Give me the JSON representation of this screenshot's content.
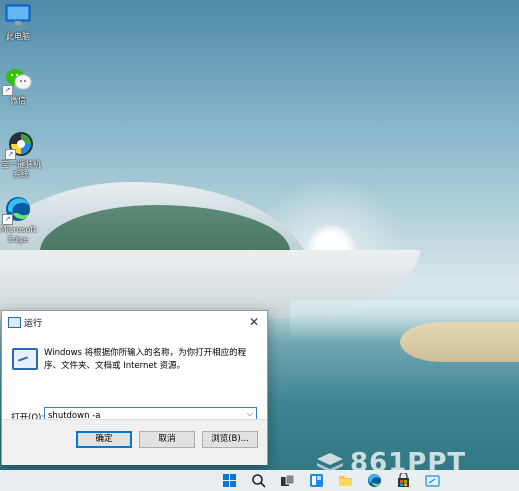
{
  "desktop": {
    "icons": [
      {
        "label": "此电脑",
        "icon": "monitor-icon"
      },
      {
        "label": "微信",
        "icon": "wechat-icon"
      },
      {
        "label": "宝一键装机系统",
        "icon": "installer-icon"
      },
      {
        "label": "Microsoft Edge",
        "icon": "edge-icon"
      }
    ]
  },
  "run_dialog": {
    "title": "运行",
    "close_glyph": "✕",
    "description": "Windows 将根据你所输入的名称，为你打开相应的程序、文件夹、文档或 Internet 资源。",
    "open_label": "打开(O):",
    "command_value": "shutdown -a",
    "ok_label": "确定",
    "cancel_label": "取消",
    "browse_label": "浏览(B)..."
  },
  "watermark": {
    "text": "861PPT"
  },
  "taskbar": {
    "items": [
      "start-icon",
      "search-icon",
      "task-view-icon",
      "widgets-icon",
      "file-explorer-icon",
      "edge-icon",
      "store-icon",
      "run-icon"
    ]
  }
}
